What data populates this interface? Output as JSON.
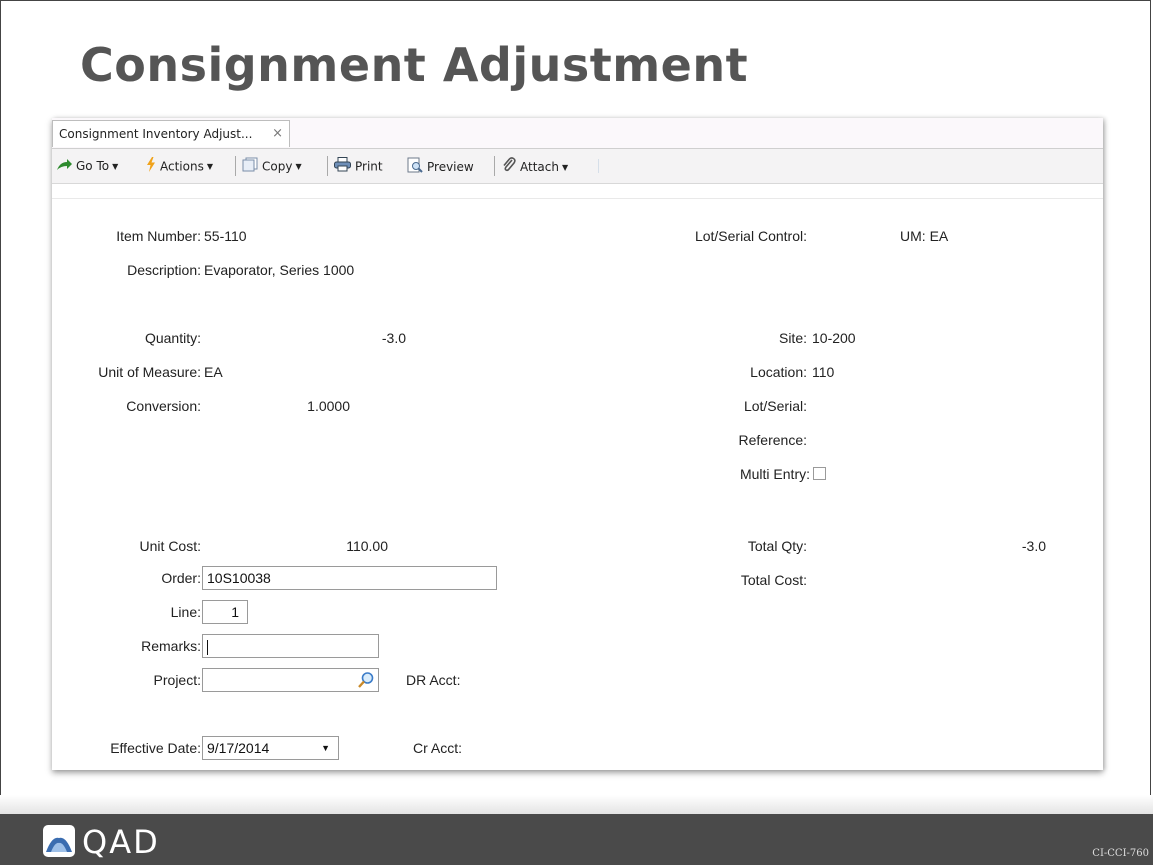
{
  "slide": {
    "title": "Consignment Adjustment",
    "course_code": "CI-CCI-760"
  },
  "tab": {
    "label": "Consignment Inventory Adjust...",
    "close": "×"
  },
  "toolbar": {
    "goto": "Go To",
    "actions": "Actions",
    "copy": "Copy",
    "print": "Print",
    "preview": "Preview",
    "attach": "Attach"
  },
  "form": {
    "item_number_label": "Item Number:",
    "item_number": "55-110",
    "description_label": "Description:",
    "description": "Evaporator, Series 1000",
    "lot_serial_control_label": "Lot/Serial Control:",
    "um_label": "UM:",
    "um": "EA",
    "quantity_label": "Quantity:",
    "quantity": "-3.0",
    "uom_label": "Unit of Measure:",
    "uom": "EA",
    "conversion_label": "Conversion:",
    "conversion": "1.0000",
    "site_label": "Site:",
    "site": "10-200",
    "location_label": "Location:",
    "location": "110",
    "lot_serial_label": "Lot/Serial:",
    "reference_label": "Reference:",
    "multi_entry_label": "Multi Entry:",
    "unit_cost_label": "Unit Cost:",
    "unit_cost": "110.00",
    "total_qty_label": "Total Qty:",
    "total_qty": "-3.0",
    "order_label": "Order:",
    "order": "10S10038",
    "total_cost_label": "Total Cost:",
    "line_label": "Line:",
    "line": "1",
    "remarks_label": "Remarks:",
    "remarks": "",
    "project_label": "Project:",
    "project": "",
    "dr_acct_label": "DR Acct:",
    "effective_date_label": "Effective Date:",
    "effective_date": "9/17/2014",
    "cr_acct_label": "Cr Acct:"
  },
  "footer": {
    "brand": "QAD"
  },
  "colors": {
    "footer_bg": "#4a4a4a",
    "title_gray": "#555555",
    "logo_blue": "#3b6db0"
  }
}
